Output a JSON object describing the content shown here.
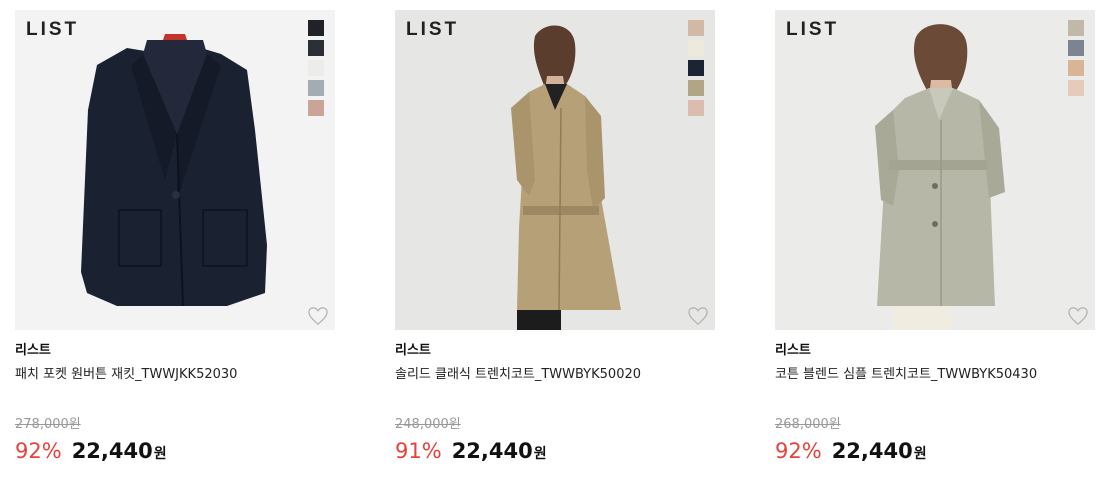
{
  "products": [
    {
      "brand": "리스트",
      "name": "패치 포켓 원버튼 재킷_TWWJKK52030",
      "logo": "LIST",
      "original_price": "278,000원",
      "discount": "92%",
      "sale_price": "22,440",
      "currency": "원",
      "swatch_colors": [
        "#1f2226",
        "#2b2f36",
        "#ececea",
        "#a3abb3",
        "#c8a597"
      ]
    },
    {
      "brand": "리스트",
      "name": "솔리드 클래식 트렌치코트_TWWBYK50020",
      "logo": "LIST",
      "original_price": "248,000원",
      "discount": "91%",
      "sale_price": "22,440",
      "currency": "원",
      "swatch_colors": [
        "#d2b9a6",
        "#eee9dd",
        "#1c2433",
        "#b2a585",
        "#dcbcae"
      ]
    },
    {
      "brand": "리스트",
      "name": "코튼 블렌드 심플 트렌치코트_TWWBYK50430",
      "logo": "LIST",
      "original_price": "268,000원",
      "discount": "92%",
      "sale_price": "22,440",
      "currency": "원",
      "swatch_colors": [
        "#c0b9a9",
        "#7d848f",
        "#d8b597",
        "#e6cbbb"
      ]
    }
  ]
}
